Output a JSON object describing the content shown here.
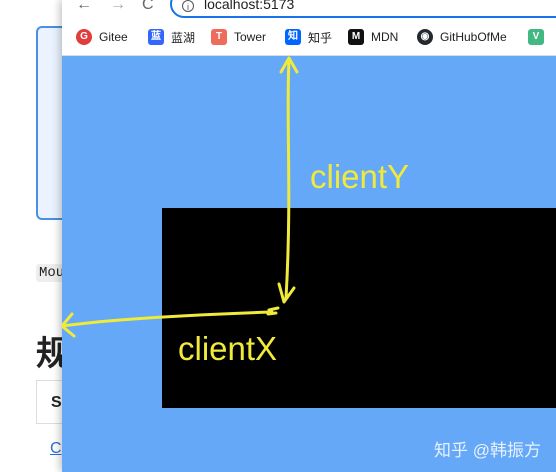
{
  "background_page": {
    "code_snippet": "Mou",
    "heading": "规",
    "table_header": "S",
    "link_text": "C"
  },
  "browser": {
    "nav": {
      "back": "←",
      "forward": "→",
      "reload": "C"
    },
    "address_bar": {
      "info_icon": "i",
      "url": "localhost:5173"
    },
    "bookmarks": [
      {
        "label": "Gitee",
        "icon": "gitee-icon",
        "color": "#e13d3d",
        "glyph": "G"
      },
      {
        "label": "蓝湖",
        "icon": "lanhu-icon",
        "color": "#3366ff",
        "glyph": "蓝"
      },
      {
        "label": "Tower",
        "icon": "tower-icon",
        "color": "#ef6b5b",
        "glyph": "T"
      },
      {
        "label": "知乎",
        "icon": "zhihu-icon",
        "color": "#0066ff",
        "glyph": "知"
      },
      {
        "label": "MDN",
        "icon": "mdn-icon",
        "color": "#111111",
        "glyph": "M"
      },
      {
        "label": "GitHubOfMe",
        "icon": "github-icon",
        "color": "#24292e",
        "glyph": "◉"
      },
      {
        "label": "",
        "icon": "vue-icon",
        "color": "#42b883",
        "glyph": "V"
      }
    ]
  },
  "canvas": {
    "background_color": "#64a8f7",
    "box_color": "#000000",
    "annotation_color": "#f0ea3a",
    "label_y": "clientY",
    "label_x": "clientX",
    "watermark": "知乎 @韩振方"
  }
}
